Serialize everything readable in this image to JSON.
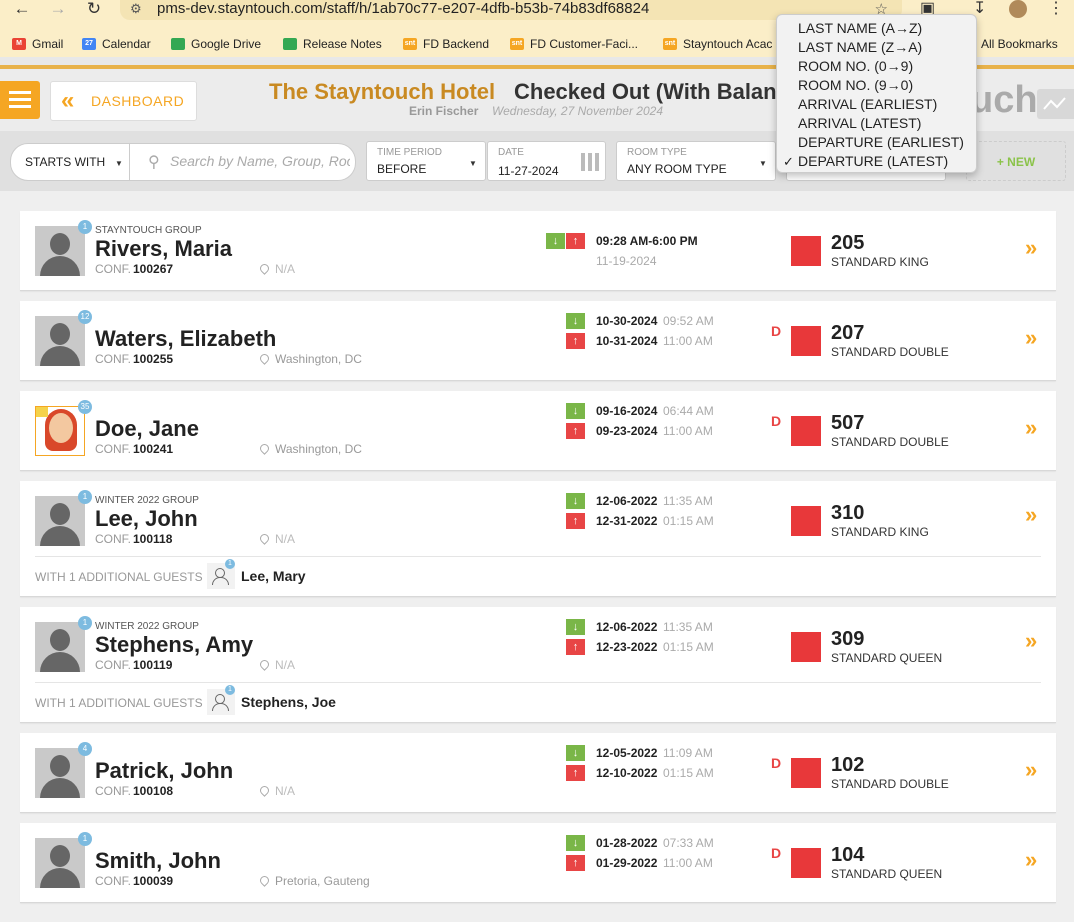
{
  "browser": {
    "url": "pms-dev.stayntouch.com/staff/h/1ab70c77-e207-4dfb-b53b-74b83df68824",
    "bookmarks": [
      "Gmail",
      "Calendar",
      "Google Drive",
      "Release Notes",
      "FD Backend",
      "FD Customer-Faci...",
      "Stayntouch Acac"
    ],
    "all_bookmarks": "All Bookmarks"
  },
  "header": {
    "dashboard_label": "DASHBOARD",
    "hotel_name": "The Stayntouch Hotel",
    "page_title": "Checked Out (With Balan",
    "user_name": "Erin Fischer",
    "date": "Wednesday, 27 November 2024",
    "brand_fragment": "uch"
  },
  "filters": {
    "starts_with": "STARTS WITH",
    "search_placeholder": "Search by Name, Group, Room",
    "time_period_label": "TIME PERIOD",
    "time_period_value": "BEFORE",
    "date_label": "DATE",
    "date_value": "11-27-2024",
    "room_type_label": "ROOM TYPE",
    "room_type_value": "ANY ROOM TYPE",
    "new_button": "+ NEW"
  },
  "sort_menu": {
    "options": [
      "LAST NAME (A→Z)",
      "LAST NAME (Z→A)",
      "ROOM NO. (0→9)",
      "ROOM NO. (9→0)",
      "ARRIVAL (EARLIEST)",
      "ARRIVAL (LATEST)",
      "DEPARTURE (EARLIEST)",
      "DEPARTURE (LATEST)"
    ],
    "selected": "DEPARTURE (LATEST)",
    "check": "✓"
  },
  "common": {
    "conf_label": "CONF.",
    "additional_guests_label": "WITH 1 ADDITIONAL GUESTS",
    "departure_flag": "D",
    "location_na": "N/A"
  },
  "reservations": [
    {
      "group": "STAYNTOUCH GROUP",
      "name": "Rivers, Maria",
      "conf": "100267",
      "location": "N/A",
      "count": "1",
      "time_range": "09:28 AM-6:00 PM",
      "date_single": "11-19-2024",
      "room": "205",
      "room_type": "STANDARD KING"
    },
    {
      "group": "",
      "name": "Waters, Elizabeth",
      "conf": "100255",
      "location": "Washington, DC",
      "count": "12",
      "arrival_date": "10-30-2024",
      "arrival_time": "09:52 AM",
      "departure_date": "10-31-2024",
      "departure_time": "11:00 AM",
      "room": "207",
      "room_type": "STANDARD DOUBLE"
    },
    {
      "group": "",
      "name": "Doe, Jane",
      "conf": "100241",
      "location": "Washington, DC",
      "count": "35",
      "arrival_date": "09-16-2024",
      "arrival_time": "06:44 AM",
      "departure_date": "09-23-2024",
      "departure_time": "11:00 AM",
      "room": "507",
      "room_type": "STANDARD DOUBLE"
    },
    {
      "group": "WINTER 2022 GROUP",
      "name": "Lee, John",
      "conf": "100118",
      "location": "N/A",
      "count": "1",
      "arrival_date": "12-06-2022",
      "arrival_time": "11:35 AM",
      "departure_date": "12-31-2022",
      "departure_time": "01:15 AM",
      "room": "310",
      "room_type": "STANDARD KING",
      "additional_guest": "Lee, Mary",
      "additional_count": "1"
    },
    {
      "group": "WINTER 2022 GROUP",
      "name": "Stephens, Amy",
      "conf": "100119",
      "location": "N/A",
      "count": "1",
      "arrival_date": "12-06-2022",
      "arrival_time": "11:35 AM",
      "departure_date": "12-23-2022",
      "departure_time": "01:15 AM",
      "room": "309",
      "room_type": "STANDARD QUEEN",
      "additional_guest": "Stephens, Joe",
      "additional_count": "1"
    },
    {
      "group": "",
      "name": "Patrick, John",
      "conf": "100108",
      "location": "N/A",
      "count": "4",
      "arrival_date": "12-05-2022",
      "arrival_time": "11:09 AM",
      "departure_date": "12-10-2022",
      "departure_time": "01:15 AM",
      "room": "102",
      "room_type": "STANDARD DOUBLE"
    },
    {
      "group": "",
      "name": "Smith, John",
      "conf": "100039",
      "location": "Pretoria, Gauteng",
      "count": "1",
      "arrival_date": "01-28-2022",
      "arrival_time": "07:33 AM",
      "departure_date": "01-29-2022",
      "departure_time": "11:00 AM",
      "room": "104",
      "room_type": "STANDARD QUEEN"
    }
  ],
  "colors": {
    "accent": "#f5a623",
    "hotel_name": "#c98a22",
    "room_status": "#e8383a",
    "arrival": "#7ab648",
    "departure": "#e84545"
  }
}
